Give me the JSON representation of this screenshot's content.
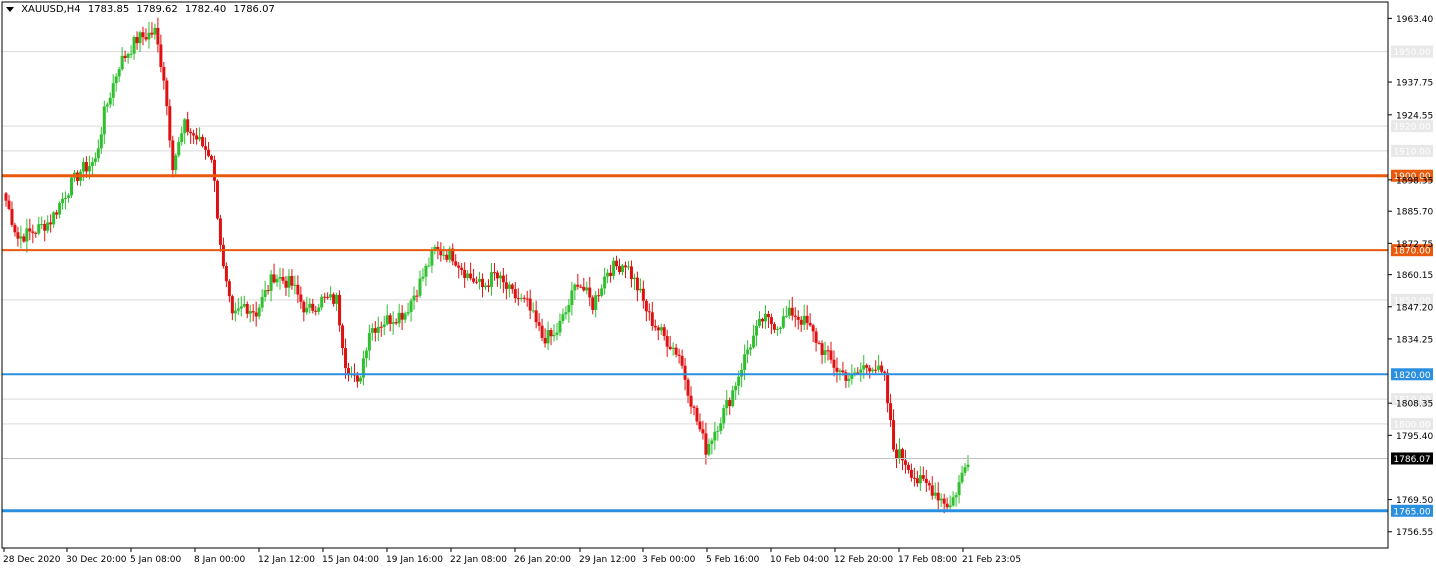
{
  "header": {
    "symbol": "XAUUSD,H4",
    "open": "1783.85",
    "high": "1789.62",
    "low": "1782.40",
    "close": "1786.07"
  },
  "colors": {
    "bull": "#2fbf2f",
    "bear": "#e01010",
    "grid": "#d9d9d9",
    "axis": "#000000",
    "resistance": "#e8590c",
    "support": "#2b8fe0"
  },
  "chart_data": {
    "type": "candlestick",
    "ylim": [
      1750.0,
      1970.0
    ],
    "y_ticks": [
      "1963.40",
      "1937.75",
      "1924.55",
      "1898.35",
      "1885.70",
      "1872.75",
      "1860.15",
      "1847.20",
      "1834.25",
      "1808.35",
      "1795.40",
      "1769.50",
      "1756.55"
    ],
    "x_ticks": [
      "28 Dec 2020",
      "30 Dec 20:00",
      "5 Jan 08:00",
      "8 Jan 00:00",
      "12 Jan 12:00",
      "15 Jan 04:00",
      "19 Jan 16:00",
      "22 Jan 08:00",
      "26 Jan 20:00",
      "29 Jan 12:00",
      "3 Feb 00:00",
      "5 Feb 16:00",
      "10 Feb 04:00",
      "12 Feb 20:00",
      "17 Feb 08:00",
      "21 Feb 23:05"
    ],
    "levels": [
      {
        "value": 1900.0,
        "label": "1900.00",
        "kind": "resistance",
        "width": 3
      },
      {
        "value": 1870.0,
        "label": "1870.00",
        "kind": "resistance",
        "width": 2
      },
      {
        "value": 1820.0,
        "label": "1820.00",
        "kind": "support",
        "width": 2
      },
      {
        "value": 1765.0,
        "label": "1765.00",
        "kind": "support",
        "width": 3
      }
    ],
    "faint_levels": [
      "1950.00",
      "1920.00",
      "1910.00",
      "1850.00",
      "1810.00",
      "1800.00"
    ],
    "current_price": "1786.07",
    "anchors": [
      [
        0,
        1890
      ],
      [
        4,
        1875
      ],
      [
        10,
        1878
      ],
      [
        15,
        1882
      ],
      [
        20,
        1893
      ],
      [
        25,
        1902
      ],
      [
        30,
        1906
      ],
      [
        33,
        1925
      ],
      [
        38,
        1945
      ],
      [
        44,
        1955
      ],
      [
        50,
        1958
      ],
      [
        53,
        1940
      ],
      [
        56,
        1905
      ],
      [
        60,
        1920
      ],
      [
        64,
        1915
      ],
      [
        69,
        1908
      ],
      [
        73,
        1862
      ],
      [
        76,
        1842
      ],
      [
        80,
        1848
      ],
      [
        84,
        1845
      ],
      [
        90,
        1860
      ],
      [
        96,
        1856
      ],
      [
        101,
        1845
      ],
      [
        106,
        1850
      ],
      [
        111,
        1850
      ],
      [
        114,
        1825
      ],
      [
        118,
        1815
      ],
      [
        122,
        1838
      ],
      [
        128,
        1842
      ],
      [
        134,
        1845
      ],
      [
        139,
        1857
      ],
      [
        144,
        1870
      ],
      [
        150,
        1868
      ],
      [
        155,
        1860
      ],
      [
        160,
        1855
      ],
      [
        164,
        1860
      ],
      [
        170,
        1852
      ],
      [
        175,
        1848
      ],
      [
        180,
        1835
      ],
      [
        184,
        1835
      ],
      [
        188,
        1845
      ],
      [
        192,
        1858
      ],
      [
        197,
        1848
      ],
      [
        202,
        1862
      ],
      [
        208,
        1865
      ],
      [
        212,
        1855
      ],
      [
        216,
        1843
      ],
      [
        221,
        1835
      ],
      [
        226,
        1828
      ],
      [
        231,
        1805
      ],
      [
        235,
        1790
      ],
      [
        239,
        1800
      ],
      [
        243,
        1810
      ],
      [
        249,
        1830
      ],
      [
        254,
        1842
      ],
      [
        259,
        1840
      ],
      [
        264,
        1845
      ],
      [
        269,
        1840
      ],
      [
        274,
        1830
      ],
      [
        279,
        1822
      ],
      [
        284,
        1818
      ],
      [
        288,
        1823
      ],
      [
        291,
        1824
      ],
      [
        295,
        1818
      ],
      [
        298,
        1790
      ],
      [
        302,
        1785
      ],
      [
        306,
        1777
      ],
      [
        310,
        1775
      ],
      [
        314,
        1770
      ],
      [
        317,
        1767
      ],
      [
        320,
        1776
      ],
      [
        323,
        1786
      ]
    ]
  }
}
